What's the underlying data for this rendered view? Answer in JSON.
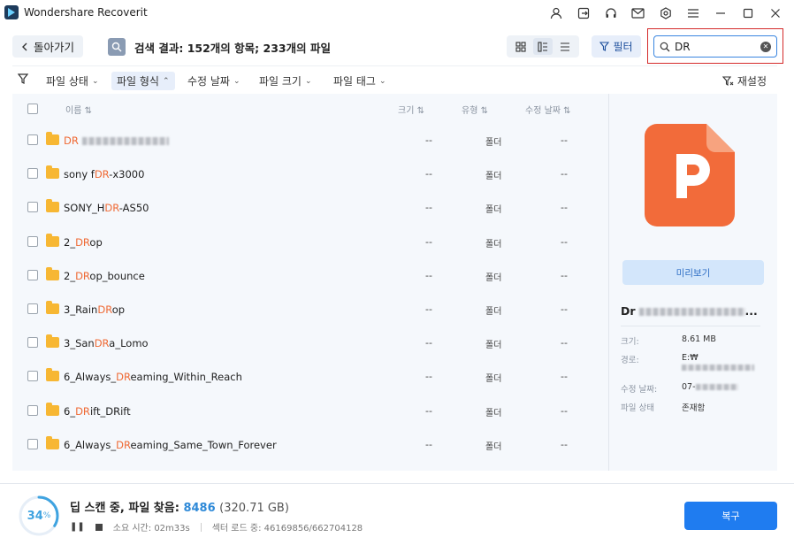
{
  "window": {
    "title": "Wondershare Recoverit",
    "icons": [
      "user-icon",
      "export-icon",
      "headset-icon",
      "mail-icon",
      "settings-icon",
      "menu-icon",
      "minimize-icon",
      "maximize-icon",
      "close-icon"
    ]
  },
  "toolbar": {
    "back_label": "돌아가기",
    "search_result": "검색 결과: 152개의 항목; 233개의 파일",
    "filter_label": "필터",
    "search_value": "DR",
    "search_placeholder": ""
  },
  "filters": {
    "items": [
      "파일 상태",
      "파일 형식",
      "수정 날짜",
      "파일 크기",
      "파일 태그"
    ],
    "active_index": 1,
    "reset_label": "재설정"
  },
  "table": {
    "columns": {
      "name": "이름",
      "size": "크기",
      "type": "유형",
      "date": "수정 날짜"
    },
    "rows": [
      {
        "pre": "",
        "hl": "DR",
        "post": "",
        "size": "--",
        "type": "폴더",
        "date": "--",
        "obscured": true
      },
      {
        "pre": "sony f",
        "hl": "DR",
        "post": "-x3000",
        "size": "--",
        "type": "폴더",
        "date": "--"
      },
      {
        "pre": "SONY_H",
        "hl": "DR",
        "post": "-AS50",
        "size": "--",
        "type": "폴더",
        "date": "--"
      },
      {
        "pre": "2_",
        "hl": "DR",
        "post": "op",
        "size": "--",
        "type": "폴더",
        "date": "--"
      },
      {
        "pre": "2_",
        "hl": "DR",
        "post": "op_bounce",
        "size": "--",
        "type": "폴더",
        "date": "--"
      },
      {
        "pre": "3_Rain",
        "hl": "DR",
        "post": "op",
        "size": "--",
        "type": "폴더",
        "date": "--"
      },
      {
        "pre": "3_San",
        "hl": "DR",
        "post": "a_Lomo",
        "size": "--",
        "type": "폴더",
        "date": "--"
      },
      {
        "pre": "6_Always_",
        "hl": "DR",
        "post": "eaming_Within_Reach",
        "size": "--",
        "type": "폴더",
        "date": "--"
      },
      {
        "pre": "6_",
        "hl": "DR",
        "post": "ift_DRift",
        "size": "--",
        "type": "폴더",
        "date": "--"
      },
      {
        "pre": "6_Always_",
        "hl": "DR",
        "post": "eaming_Same_Town_Forever",
        "size": "--",
        "type": "폴더",
        "date": "--"
      }
    ]
  },
  "preview": {
    "button_label": "미리보기",
    "file_name": "Dr",
    "labels": {
      "size": "크기:",
      "path": "경로:",
      "modified": "수정 날짜:",
      "status": "파일 상태"
    },
    "values": {
      "size": "8.61 MB",
      "path": "E:₩",
      "modified": "07-",
      "status": "존재함"
    },
    "file_icon": "ppt-file-icon",
    "accent": "#f26b3a"
  },
  "status": {
    "progress": 34,
    "scan_label": "딥 스캔 중, 파일 찾음:",
    "found_count": "8486",
    "found_size": "(320.71 GB)",
    "elapsed_label": "소요 시간:",
    "elapsed": "02m33s",
    "sectors_label": "섹터 로드 중:",
    "sectors": "46169856/662704128",
    "restore_label": "복구",
    "accent": "#1f7cf0"
  }
}
